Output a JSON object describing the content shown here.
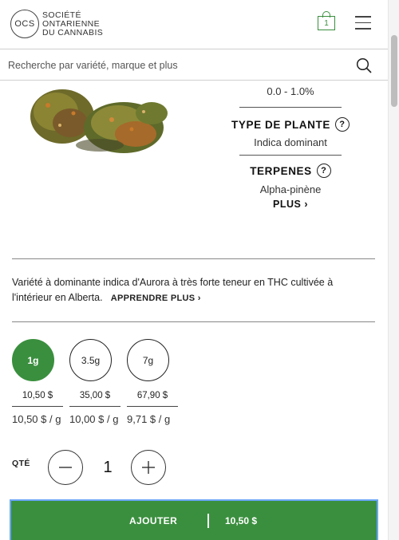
{
  "header": {
    "logo_mark": "OCS",
    "logo_lines": [
      "SOCIÉTÉ",
      "ONTARIENNE",
      "DU CANNABIS"
    ],
    "cart_count": "1"
  },
  "search": {
    "placeholder": "Recherche par variété, marque et plus"
  },
  "product": {
    "cbd_range": "0.0 - 1.0%",
    "plant_type_title": "TYPE DE PLANTE",
    "plant_type_value": "Indica dominant",
    "terpenes_title": "TERPENES",
    "terpenes_value": "Alpha-pinène",
    "more_label": "PLUS",
    "description": "Variété à dominante indica d'Aurora à très forte teneur en THC cultivée à l'intérieur en Alberta.",
    "learn_more": "APPRENDRE PLUS"
  },
  "sizes": [
    {
      "label": "1g",
      "price": "10,50 $",
      "unit_price": "10,50 $ / g",
      "selected": true
    },
    {
      "label": "3.5g",
      "price": "35,00 $",
      "unit_price": "10,00 $ / g",
      "selected": false
    },
    {
      "label": "7g",
      "price": "67,90 $",
      "unit_price": "9,71 $ / g",
      "selected": false
    }
  ],
  "quantity": {
    "label": "QTÉ",
    "value": "1"
  },
  "add_button": {
    "label": "AJOUTER",
    "price": "10,50 $"
  },
  "colors": {
    "accent": "#3a8f3e",
    "focus": "#6aa6f7"
  }
}
